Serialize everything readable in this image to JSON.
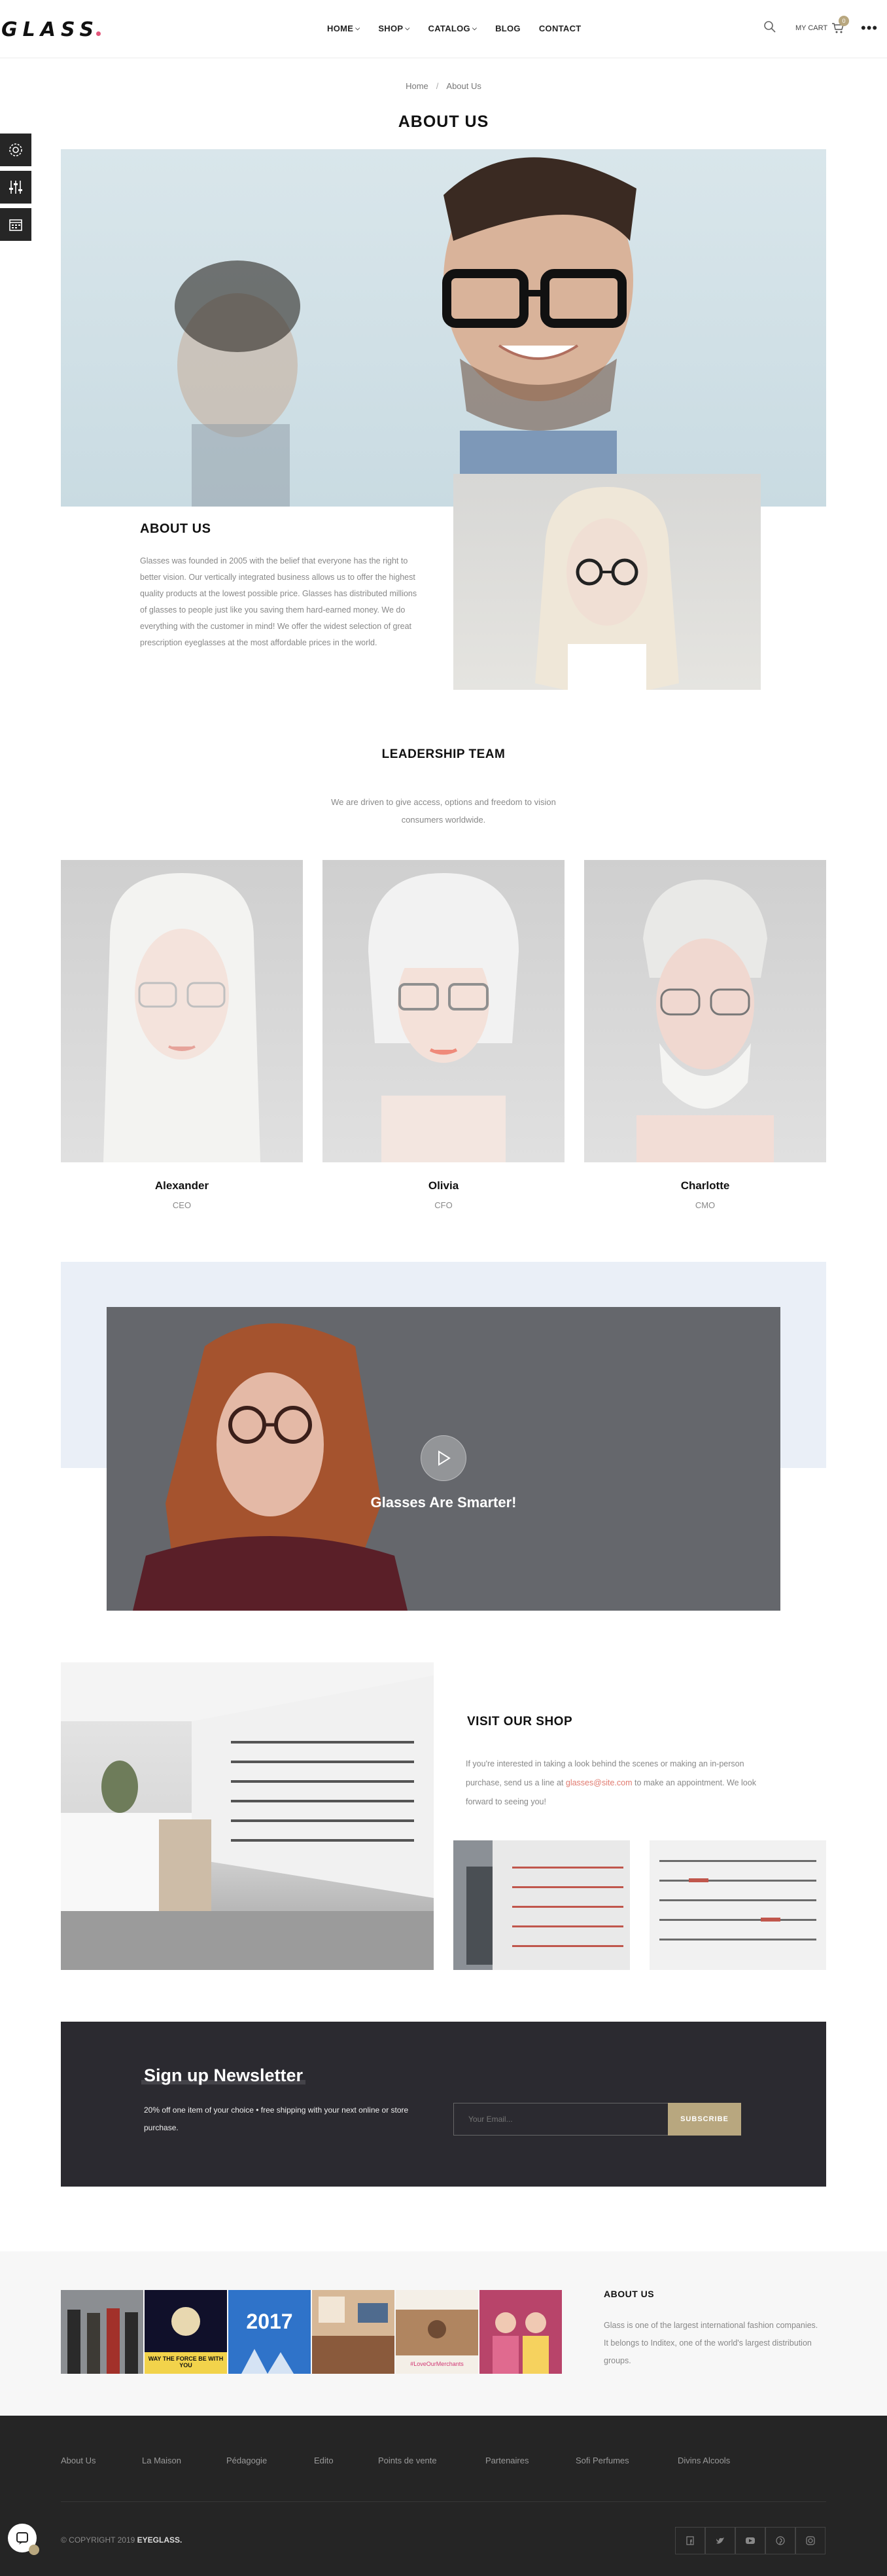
{
  "header": {
    "logo": "GLASS",
    "nav": [
      {
        "label": "HOME",
        "dropdown": true
      },
      {
        "label": "SHOP",
        "dropdown": true
      },
      {
        "label": "CATALOG",
        "dropdown": true
      },
      {
        "label": "BLOG",
        "dropdown": false
      },
      {
        "label": "CONTACT",
        "dropdown": false
      }
    ],
    "cart_label": "MY CART",
    "cart_count": "0",
    "more_label": "•••"
  },
  "tools": [
    "gear-icon",
    "sliders-icon",
    "calendar-icon"
  ],
  "breadcrumb": {
    "home": "Home",
    "separator": "/",
    "current": "About Us"
  },
  "page_title": "ABOUT US",
  "about": {
    "heading": "ABOUT US",
    "text": "Glasses was founded in 2005 with the belief that everyone has the right to better vision. Our vertically integrated business allows us to offer the highest quality products at the lowest possible price. Glasses has distributed millions of glasses to people just like you saving them hard-earned money. We do everything with the customer in mind! We offer the widest selection of great prescription eyeglasses at the most affordable prices in the world."
  },
  "leadership": {
    "heading": "LEADERSHIP TEAM",
    "subtitle": "We are driven to give access, options and freedom to vision consumers worldwide.",
    "members": [
      {
        "name": "Alexander",
        "role": "CEO"
      },
      {
        "name": "Olivia",
        "role": "CFO"
      },
      {
        "name": "Charlotte",
        "role": "CMO"
      }
    ]
  },
  "video": {
    "caption": "Glasses Are Smarter!"
  },
  "shop": {
    "heading": "VISIT OUR SHOP",
    "text_before": "If you're interested in taking a look behind the scenes or making an in-person purchase, send us a line at ",
    "link": "glasses@site.com",
    "text_after": " to make an appointment. We look forward to seeing you!"
  },
  "newsletter": {
    "title": "Sign up Newsletter",
    "text": "20% off one item of your choice • free shipping with your next online or store purchase.",
    "placeholder": "Your Email...",
    "button": "SUBSCRIBE"
  },
  "instagram_year": "2017",
  "instagram_banner": "WAY THE FORCE BE WITH YOU",
  "instagram_tag": "#LoveOurMerchants",
  "footer_about": {
    "title": "ABOUT US",
    "text": "Glass is one of the largest international fashion companies. It belongs to Inditex, one of the world's largest distribution groups."
  },
  "footer_links": [
    "About Us",
    "La Maison",
    "Pédagogie",
    "Edito",
    "Points de vente",
    "Partenaires",
    "Sofi Perfumes",
    "Divins Alcools"
  ],
  "copyright": {
    "prefix": "© COPYRIGHT 2019 ",
    "brand": "EYEGLASS."
  },
  "social": [
    "facebook-icon",
    "twitter-icon",
    "youtube-icon",
    "pinterest-icon",
    "instagram-icon"
  ]
}
